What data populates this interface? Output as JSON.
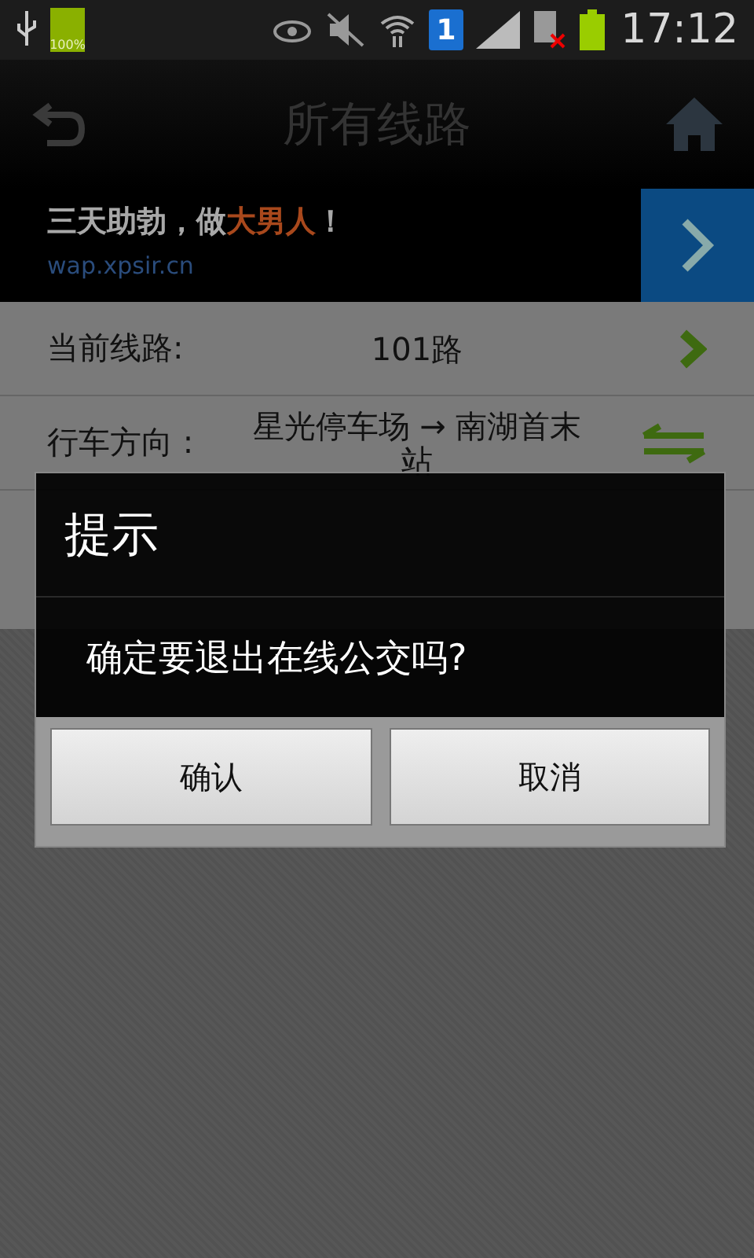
{
  "status_bar": {
    "battery_label": "100%",
    "sim_badge": "1",
    "time": "17:12"
  },
  "header": {
    "title": "所有线路"
  },
  "ad": {
    "headline": [
      {
        "text": "三天助勃，做",
        "highlight": false
      },
      {
        "text": "大男人",
        "highlight": true
      },
      {
        "text": "！",
        "highlight": false
      }
    ],
    "url": "wap.xpsir.cn"
  },
  "rows": [
    {
      "kind": "link",
      "label": "当前线路:",
      "value": "101路"
    },
    {
      "kind": "swap",
      "label": "行车方向 :",
      "value": "星光停车场 → 南湖首末站"
    }
  ],
  "dialog": {
    "title": "提示",
    "message": "确定要退出在线公交吗?",
    "buttons": [
      "确认",
      "取消"
    ]
  }
}
